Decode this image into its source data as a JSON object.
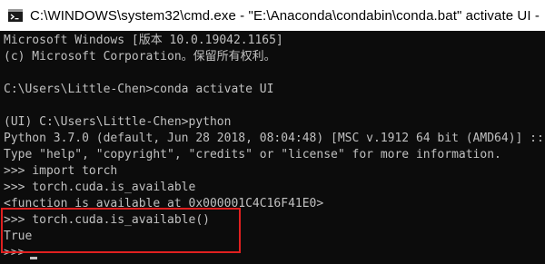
{
  "window": {
    "title": "C:\\WINDOWS\\system32\\cmd.exe - \"E:\\Anaconda\\condabin\\conda.bat\"  activate UI - "
  },
  "console": {
    "lines": [
      "Microsoft Windows [版本 10.0.19042.1165]",
      "(c) Microsoft Corporation。保留所有权利。",
      "",
      "C:\\Users\\Little-Chen>conda activate UI",
      "",
      "(UI) C:\\Users\\Little-Chen>python",
      "Python 3.7.0 (default, Jun 28 2018, 08:04:48) [MSC v.1912 64 bit (AMD64)] ::",
      "Type \"help\", \"copyright\", \"credits\" or \"license\" for more information.",
      ">>> import torch",
      ">>> torch.cuda.is_available",
      "<function is_available at 0x000001C4C16F41E0>",
      ">>> torch.cuda.is_available()",
      "True",
      ">>>"
    ]
  },
  "icons": {
    "app": "cmd-terminal-icon"
  },
  "colors": {
    "console_background": "#0c0c0c",
    "console_text": "#c0c0c0",
    "highlight_border": "#e02020",
    "titlebar_background": "#ffffff"
  }
}
